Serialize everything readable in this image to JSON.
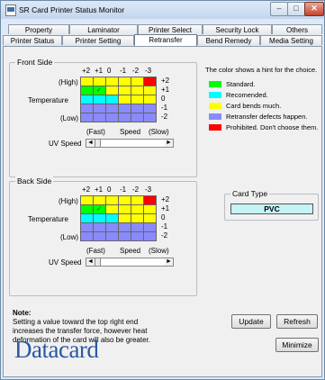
{
  "window": {
    "title": "SR Card Printer Status Monitor"
  },
  "tabs_row1": [
    "Property",
    "Laminator",
    "Printer Select",
    "Security Lock",
    "Others"
  ],
  "tabs_row2": [
    "Printer Status",
    "Printer Setting",
    "Retransfer",
    "Bend Remedy",
    "Media Setting"
  ],
  "active_tab": "Retransfer",
  "front": {
    "title": "Front Side",
    "col_labels": [
      "+2",
      "+1",
      "0",
      "-1",
      "-2",
      "-3"
    ],
    "row_labels": [
      "+2",
      "+1",
      "0",
      "-1",
      "-2"
    ],
    "high_label": "(High)",
    "temp_label": "Temperature",
    "low_label": "(Low)",
    "fast_label": "(Fast)",
    "speed_label": "Speed",
    "slow_label": "(Slow)",
    "uv_label": "UV Speed",
    "grid_colors": [
      [
        "#ffff00",
        "#ffff00",
        "#ffff00",
        "#ffff00",
        "#ffff00",
        "#ff0000"
      ],
      [
        "#00ff00",
        "#00ff00",
        "#ffff00",
        "#ffff00",
        "#ffff00",
        "#ffff00"
      ],
      [
        "#00ffff",
        "#00ffff",
        "#00ffff",
        "#ffff00",
        "#ffff00",
        "#ffff00"
      ],
      [
        "#8a8aff",
        "#8a8aff",
        "#8a8aff",
        "#8a8aff",
        "#8a8aff",
        "#8a8aff"
      ],
      [
        "#8a8aff",
        "#8a8aff",
        "#8a8aff",
        "#8a8aff",
        "#8a8aff",
        "#8a8aff"
      ]
    ],
    "selected": {
      "row": 1,
      "col": 1
    }
  },
  "back": {
    "title": "Back Side",
    "col_labels": [
      "+2",
      "+1",
      "0",
      "-1",
      "-2",
      "-3"
    ],
    "row_labels": [
      "+2",
      "+1",
      "0",
      "-1",
      "-2"
    ],
    "high_label": "(High)",
    "temp_label": "Temperature",
    "low_label": "(Low)",
    "fast_label": "(Fast)",
    "speed_label": "Speed",
    "slow_label": "(Slow)",
    "uv_label": "UV Speed",
    "grid_colors": [
      [
        "#ffff00",
        "#ffff00",
        "#ffff00",
        "#ffff00",
        "#ffff00",
        "#ff0000"
      ],
      [
        "#00ff00",
        "#00ff00",
        "#ffff00",
        "#ffff00",
        "#ffff00",
        "#ffff00"
      ],
      [
        "#00ffff",
        "#00ffff",
        "#00ffff",
        "#ffff00",
        "#ffff00",
        "#ffff00"
      ],
      [
        "#8a8aff",
        "#8a8aff",
        "#8a8aff",
        "#8a8aff",
        "#8a8aff",
        "#8a8aff"
      ],
      [
        "#8a8aff",
        "#8a8aff",
        "#8a8aff",
        "#8a8aff",
        "#8a8aff",
        "#8a8aff"
      ]
    ],
    "selected": {
      "row": 1,
      "col": 1
    }
  },
  "legend": {
    "hint": "The color shows a hint for the choice.",
    "items": [
      {
        "color": "#00ff00",
        "label": "Standard."
      },
      {
        "color": "#00ffff",
        "label": "Recomended."
      },
      {
        "color": "#ffff00",
        "label": "Card bends much."
      },
      {
        "color": "#8a8aff",
        "label": "Retransfer defects happen."
      },
      {
        "color": "#ff0000",
        "label": "Prohibited. Don't choose them."
      }
    ]
  },
  "card_type": {
    "label": "Card Type",
    "value": "PVC"
  },
  "note": {
    "title": "Note:",
    "line1": "Setting a value toward the top right end",
    "line2": "increases the transfer force, however heat",
    "line3": "deformation of the card will also be greater."
  },
  "buttons": {
    "update": "Update",
    "refresh": "Refresh",
    "minimize": "Minimize"
  },
  "logo": "Datacard",
  "glyphs": {
    "minimize": "–",
    "maximize": "□",
    "close": "✕",
    "left": "◄",
    "right": "►",
    "check": "✓"
  }
}
